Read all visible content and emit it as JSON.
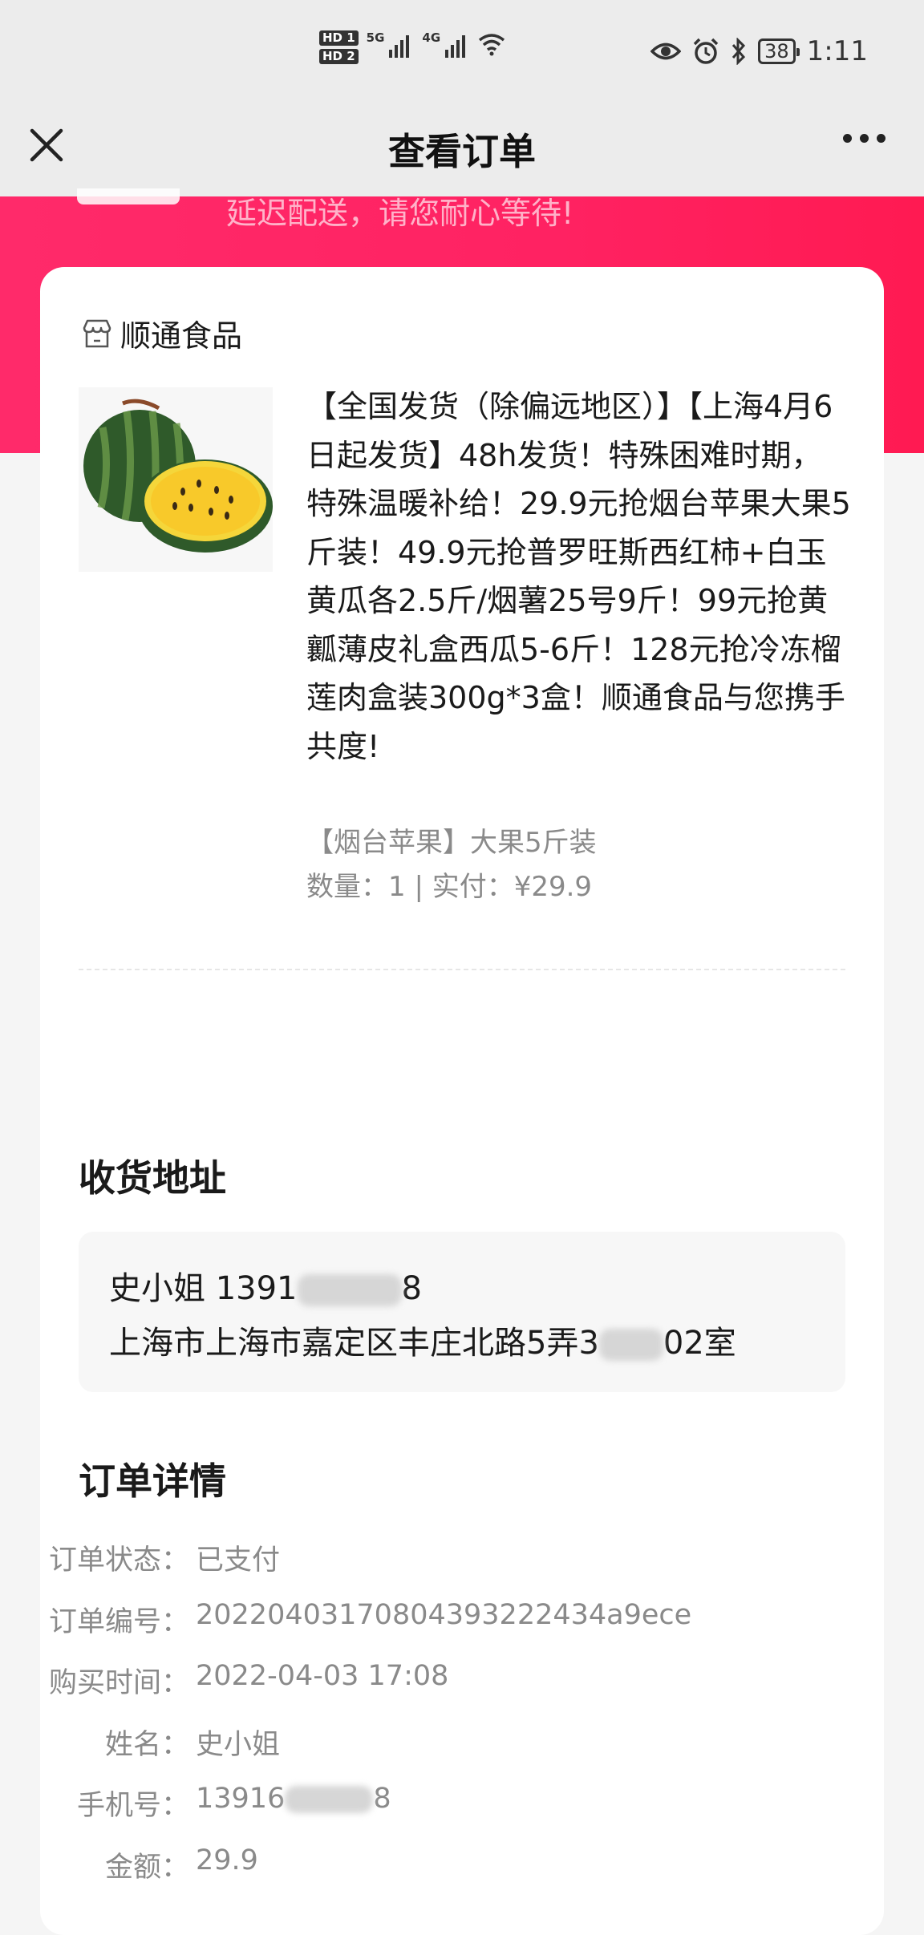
{
  "status_bar": {
    "hd1": "HD 1",
    "hd2": "HD 2",
    "net1": "5G",
    "net2": "4G",
    "battery": "38",
    "time": "1:11"
  },
  "nav": {
    "title": "查看订单"
  },
  "banner": {
    "text": "延迟配送，请您耐心等待!"
  },
  "shop": {
    "name": "顺通食品"
  },
  "product": {
    "title": "【全国发货（除偏远地区）】【上海4月6日起发货】48h发货！特殊困难时期，特殊温暖补给！29.9元抢烟台苹果大果5斤装！49.9元抢普罗旺斯西红柿+白玉黄瓜各2.5斤/烟薯25号9斤！99元抢黄瓤薄皮礼盒西瓜5-6斤！128元抢冷冻榴莲肉盒装300g*3盒！顺通食品与您携手共度!",
    "spec": "【烟台苹果】大果5斤装",
    "qty_line": "数量：1 | 实付：¥29.9"
  },
  "address": {
    "section_title": "收货地址",
    "name_prefix": "史小姐 1391",
    "name_suffix": "8",
    "addr_prefix": "上海市上海市嘉定区丰庄北路5弄3",
    "addr_suffix": "02室"
  },
  "order": {
    "section_title": "订单详情",
    "rows": [
      {
        "label": "订单状态：",
        "value": "已支付"
      },
      {
        "label": "订单编号：",
        "value": "20220403170804393222434a9ece"
      },
      {
        "label": "购买时间：",
        "value": "2022-04-03 17:08"
      },
      {
        "label": "姓名：",
        "value": "史小姐"
      },
      {
        "label": "手机号：",
        "value": "13916",
        "value_suffix": "8"
      },
      {
        "label": "金额：",
        "value": "29.9"
      }
    ]
  },
  "colors": {
    "banner": "#ff2262",
    "muted_text": "#8a8a8a"
  }
}
